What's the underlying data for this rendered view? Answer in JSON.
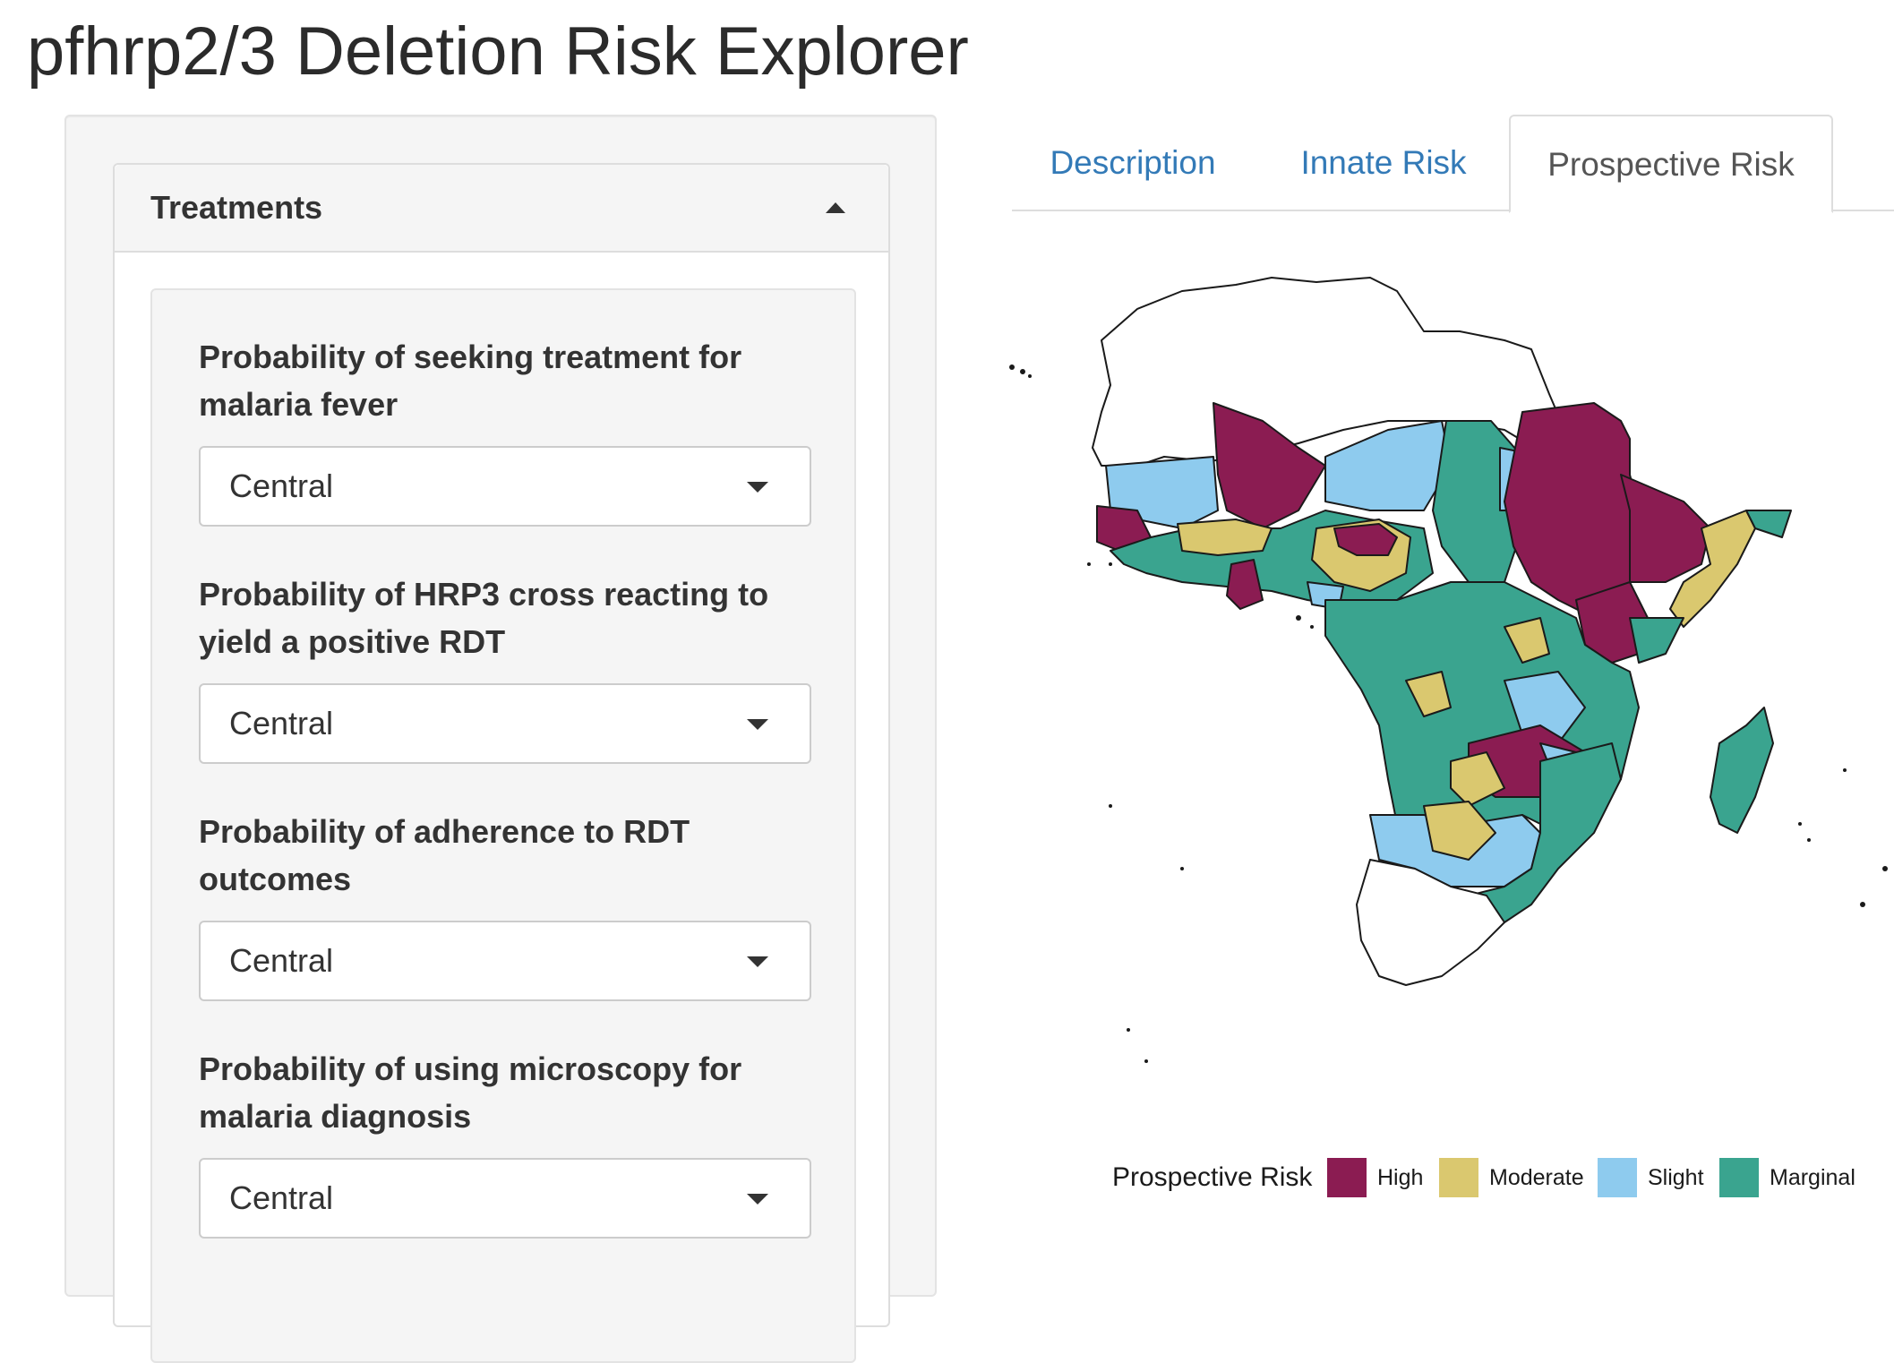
{
  "app": {
    "title": "pfhrp2/3 Deletion Risk Explorer"
  },
  "sidebar": {
    "panel_title": "Treatments",
    "fields": [
      {
        "label": "Probability of seeking treatment for malaria fever",
        "value": "Central"
      },
      {
        "label": "Probability of HRP3 cross reacting to yield a positive RDT",
        "value": "Central"
      },
      {
        "label": "Probability of adherence to RDT outcomes",
        "value": "Central"
      },
      {
        "label": "Probability of using microscopy for malaria diagnosis",
        "value": "Central"
      }
    ]
  },
  "tabs": [
    {
      "label": "Description",
      "active": false
    },
    {
      "label": "Innate Risk",
      "active": false
    },
    {
      "label": "Prospective Risk",
      "active": true
    }
  ],
  "map": {
    "legend_title": "Prospective Risk",
    "categories": [
      {
        "label": "High",
        "color": "#8b1c52"
      },
      {
        "label": "Moderate",
        "color": "#dac86f"
      },
      {
        "label": "Slight",
        "color": "#8ecbee"
      },
      {
        "label": "Marginal",
        "color": "#3aa48f"
      }
    ],
    "no_data_color": "#ffffff",
    "border_color": "#1a1a1a"
  }
}
